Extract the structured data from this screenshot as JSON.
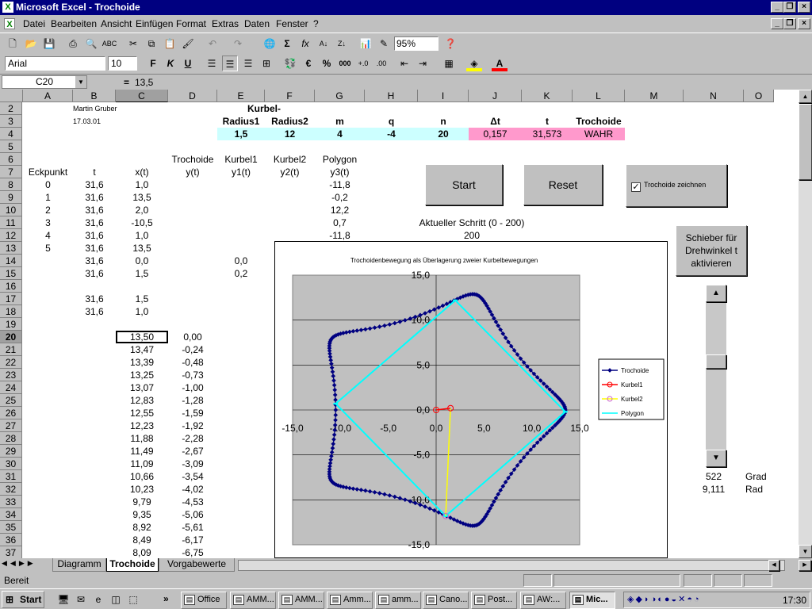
{
  "window": {
    "title": "Microsoft Excel - Trochoide",
    "icon": "excel-icon"
  },
  "menu": [
    "Datei",
    "Bearbeiten",
    "Ansicht",
    "Einfügen",
    "Format",
    "Extras",
    "Daten",
    "Fenster",
    "?"
  ],
  "toolbar": {
    "zoom": "95%",
    "font": "Arial",
    "size": "10",
    "bold": "F",
    "italic": "K",
    "underline": "U",
    "currency": "€",
    "percent": "%",
    "thousands": "000"
  },
  "formula": {
    "cell": "C20",
    "eq": "=",
    "value": "13,5"
  },
  "columns": [
    {
      "l": "A",
      "w": 63
    },
    {
      "l": "B",
      "w": 54
    },
    {
      "l": "C",
      "w": 66
    },
    {
      "l": "D",
      "w": 62
    },
    {
      "l": "E",
      "w": 60
    },
    {
      "l": "F",
      "w": 63
    },
    {
      "l": "G",
      "w": 63
    },
    {
      "l": "H",
      "w": 67
    },
    {
      "l": "I",
      "w": 64
    },
    {
      "l": "J",
      "w": 67
    },
    {
      "l": "K",
      "w": 64
    },
    {
      "l": "L",
      "w": 66
    },
    {
      "l": "M",
      "w": 74
    },
    {
      "l": "N",
      "w": 76
    },
    {
      "l": "O",
      "w": 38
    }
  ],
  "rows": [
    "2",
    "3",
    "4",
    "5",
    "6",
    "7",
    "8",
    "9",
    "10",
    "11",
    "12",
    "13",
    "14",
    "15",
    "16",
    "17",
    "18",
    "19",
    "20",
    "21",
    "22",
    "23",
    "24",
    "25",
    "26",
    "27",
    "28",
    "29",
    "30",
    "31",
    "32",
    "33",
    "34",
    "35",
    "36",
    "37"
  ],
  "cells": {
    "author": "Martin Gruber",
    "date": "17.03.01",
    "kurbel_head": "Kurbel-",
    "param_headers": [
      "Radius1",
      "Radius2",
      "m",
      "q",
      "n",
      "Δt",
      "t",
      "Trochoide"
    ],
    "param_values": [
      "1,5",
      "12",
      "4",
      "-4",
      "20",
      "0,157",
      "31,573",
      "WAHR"
    ],
    "hdr6": {
      "d": "Trochoide",
      "e": "Kurbel1",
      "f": "Kurbel2",
      "g": "Polygon"
    },
    "hdr7": {
      "a": "Eckpunkt",
      "b": "t",
      "c": "x(t)",
      "d": "y(t)",
      "e": "y1(t)",
      "f": "y2(t)",
      "g": "y3(t)"
    },
    "eck": [
      "0",
      "1",
      "2",
      "3",
      "4",
      "5"
    ],
    "tcol": [
      "31,6",
      "31,6",
      "31,6",
      "31,6",
      "31,6",
      "31,6",
      "31,6",
      "31,6",
      "",
      "31,6",
      "31,6"
    ],
    "xcol": [
      "1,0",
      "13,5",
      "2,0",
      "-10,5",
      "1,0",
      "13,5",
      "0,0",
      "1,5",
      "",
      "1,5",
      "1,0"
    ],
    "ycol": [
      "-11,8",
      "-0,2",
      "12,2",
      "0,7",
      "-11,8"
    ],
    "e14": "0,0",
    "e15": "0,2",
    "trochoide_x": [
      "13,50",
      "13,47",
      "13,39",
      "13,25",
      "13,07",
      "12,83",
      "12,55",
      "12,23",
      "11,88",
      "11,49",
      "11,09",
      "10,66",
      "10,23",
      "9,79",
      "9,35",
      "8,92",
      "8,49",
      "8,09"
    ],
    "trochoide_y": [
      "0,00",
      "-0,24",
      "-0,48",
      "-0,73",
      "-1,00",
      "-1,28",
      "-1,59",
      "-1,92",
      "-2,28",
      "-2,67",
      "-3,09",
      "-3,54",
      "-4,02",
      "-4,53",
      "-5,06",
      "-5,61",
      "-6,17",
      "-6,75"
    ],
    "step_label": "Aktueller Schritt (0 - 200)",
    "step_value": "200",
    "grad_value": "522",
    "grad_unit": "Grad",
    "rad_value": "9,111",
    "rad_unit": "Rad"
  },
  "controls": {
    "start": "Start",
    "reset": "Reset",
    "checkbox": "Trochoide zeichnen",
    "checked": true,
    "slider_btn": "Schieber für Drehwinkel t aktivieren"
  },
  "sheet_tabs": [
    "Diagramm",
    "Trochoide",
    "Vorgabewerte"
  ],
  "active_tab": "Trochoide",
  "status": "Bereit",
  "taskbar": {
    "start": "Start",
    "clock": "17:30",
    "tasks": [
      "Office",
      "AMM...",
      "AMM...",
      "Amm...",
      "amm...",
      "Cano...",
      "Post...",
      "AW:...",
      "Mic..."
    ]
  },
  "chart_data": {
    "type": "scatter",
    "title": "Trochoidenbewegung als Überlagerung zweier Kurbelbewegungen",
    "xlim": [
      -15,
      15
    ],
    "ylim": [
      -15,
      15
    ],
    "xticks": [
      "-15,0",
      "-10,0",
      "-5,0",
      "0,0",
      "5,0",
      "10,0",
      "15,0"
    ],
    "yticks": [
      "15,0",
      "10,0",
      "5,0",
      "0,0",
      "-5,0",
      "-10,0",
      "-15,0"
    ],
    "legend_position": "right",
    "colors": {
      "Trochoide": "#000080",
      "Kurbel1": "#ff0000",
      "Kurbel2": "#ffff00",
      "Polygon": "#00ffff"
    },
    "series": [
      {
        "name": "Trochoide",
        "params": {
          "R": 12,
          "r": 1.5,
          "m": 4,
          "q": -4,
          "n": 20
        }
      },
      {
        "name": "Kurbel1",
        "x": [
          0,
          1.5
        ],
        "y": [
          0,
          0.2
        ]
      },
      {
        "name": "Kurbel2",
        "x": [
          1.5,
          1.0
        ],
        "y": [
          0.2,
          -11.8
        ]
      },
      {
        "name": "Polygon",
        "x": [
          1.0,
          13.5,
          2.0,
          -10.5,
          1.0
        ],
        "y": [
          -11.8,
          -0.2,
          12.2,
          0.7,
          -11.8
        ]
      }
    ]
  }
}
